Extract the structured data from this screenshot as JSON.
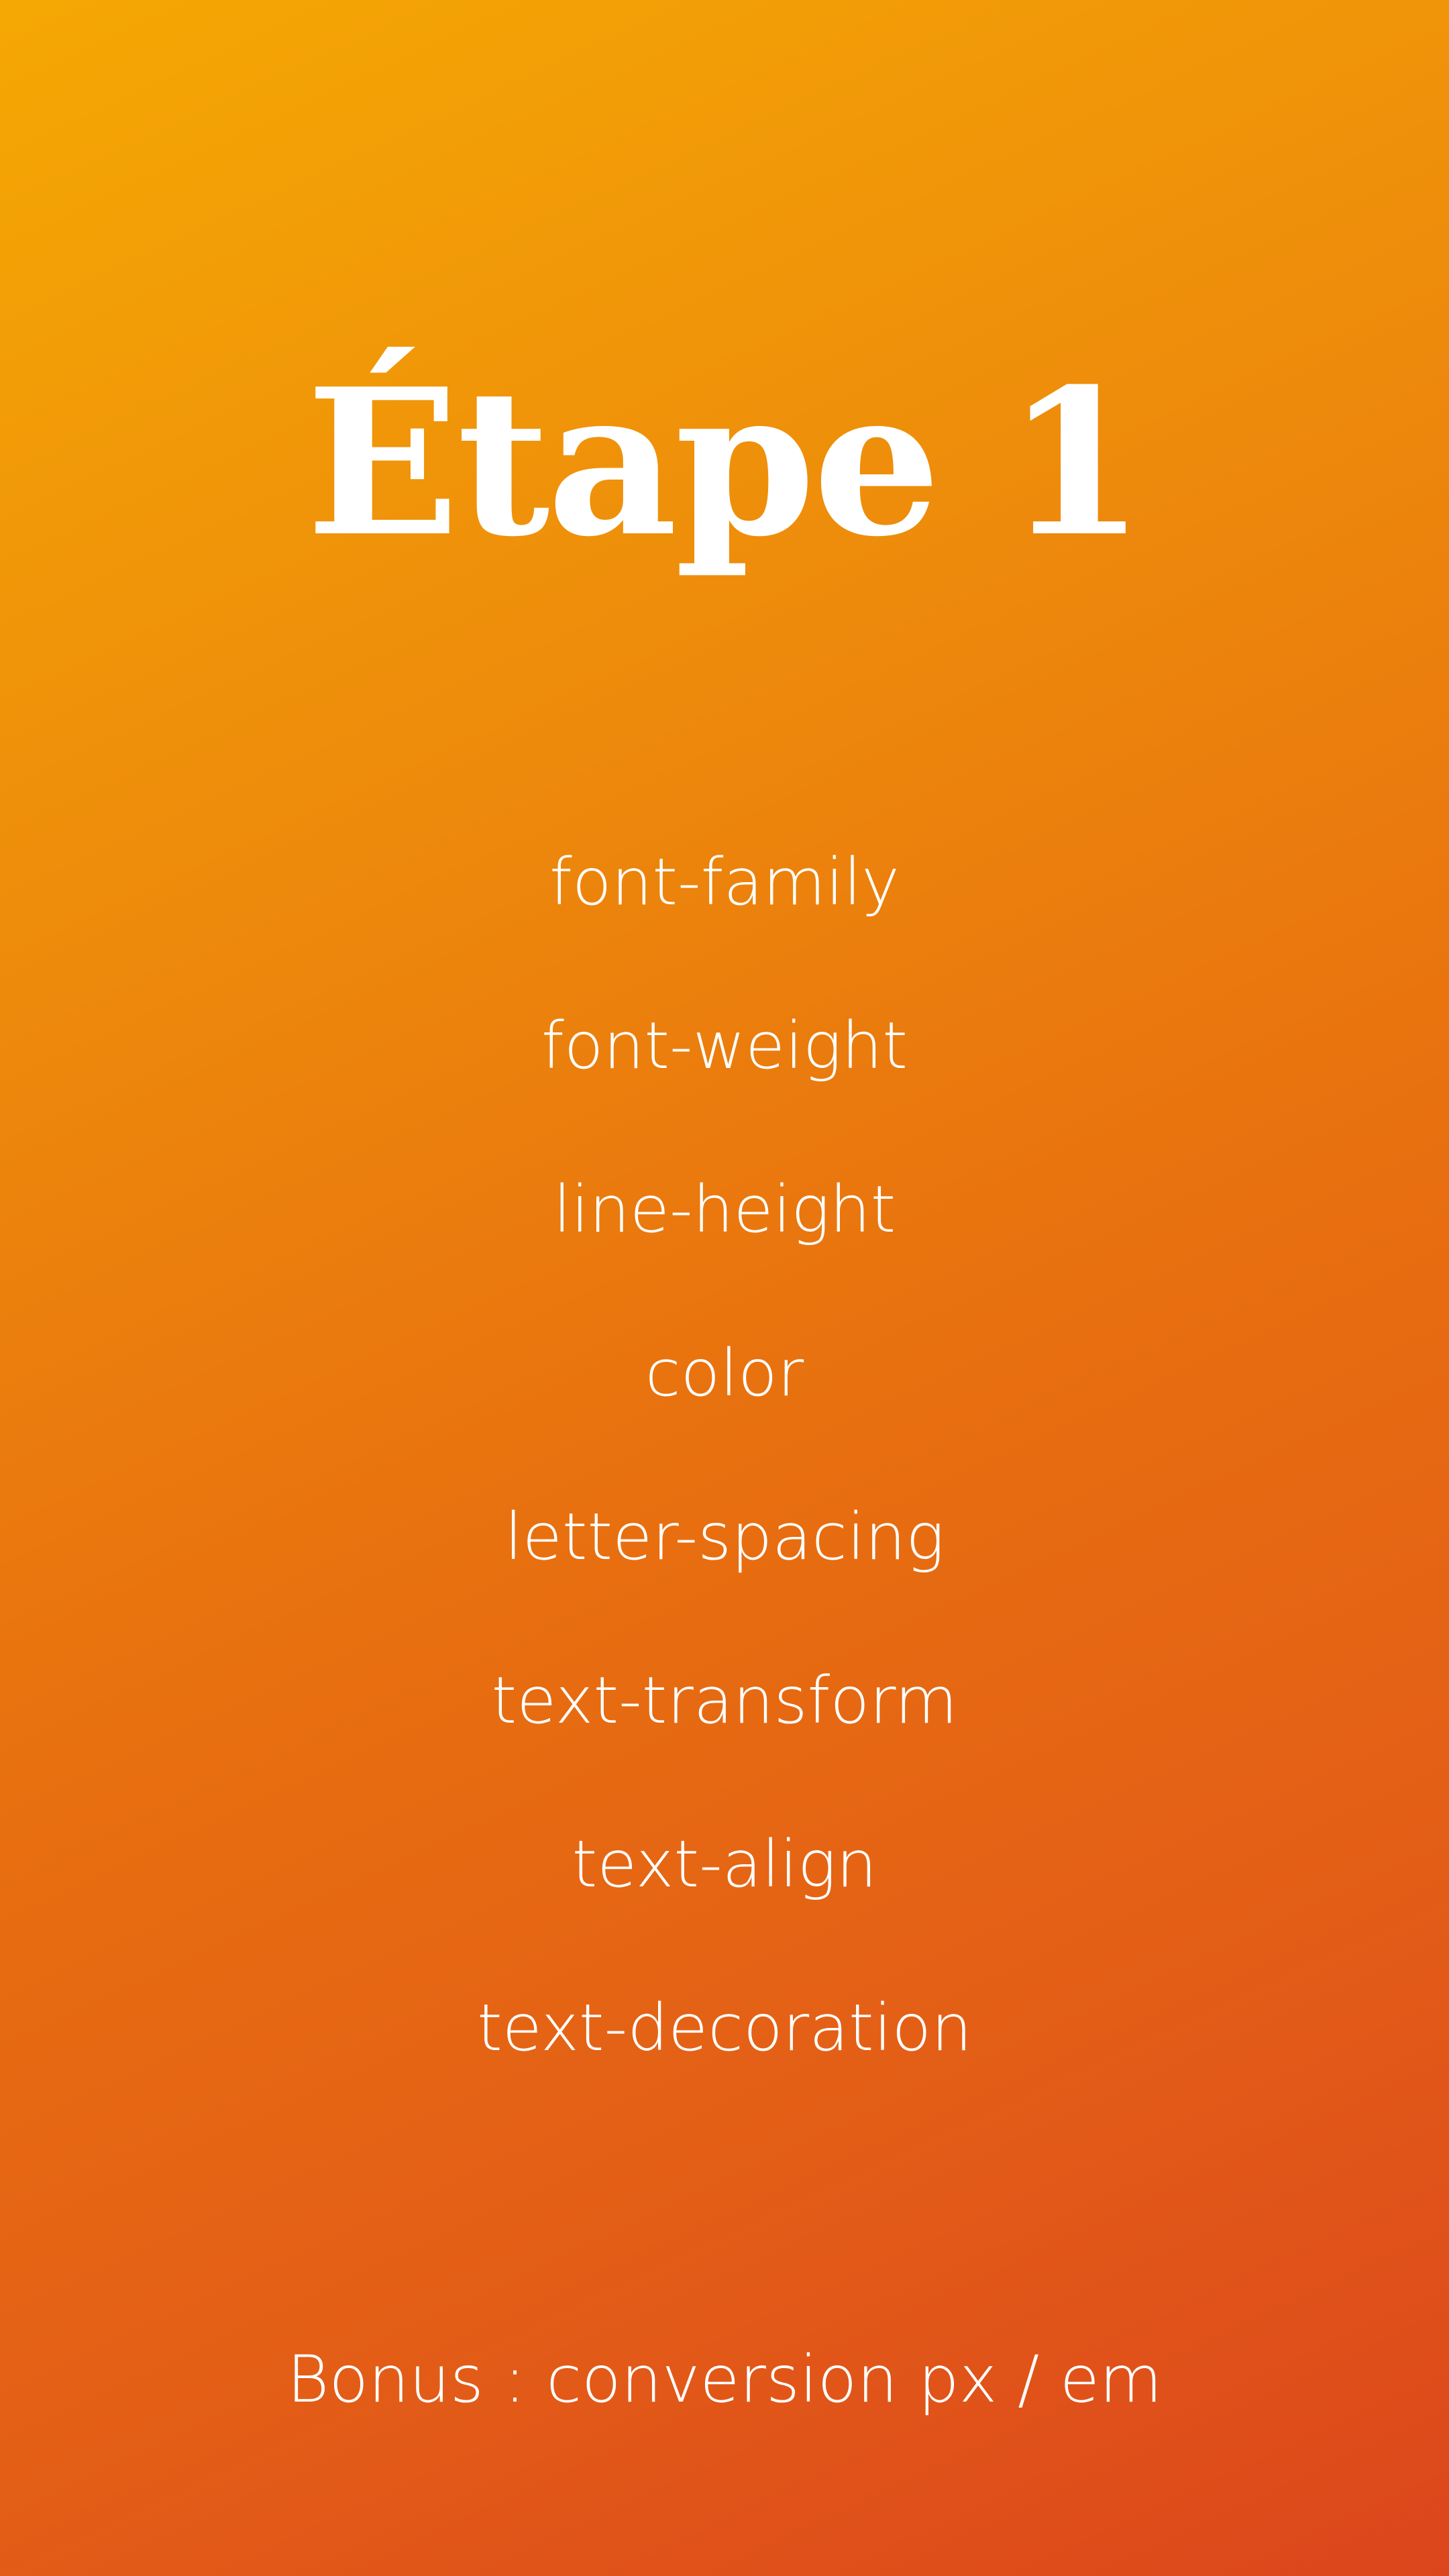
{
  "background": {
    "gradient_start": "#f5a803",
    "gradient_end": "#dc461c"
  },
  "title": "Étape 1",
  "properties": [
    "font-family",
    "font-weight",
    "line-height",
    "color",
    "letter-spacing",
    "text-transform",
    "text-align",
    "text-decoration"
  ],
  "bonus": "Bonus : conversion px / em"
}
